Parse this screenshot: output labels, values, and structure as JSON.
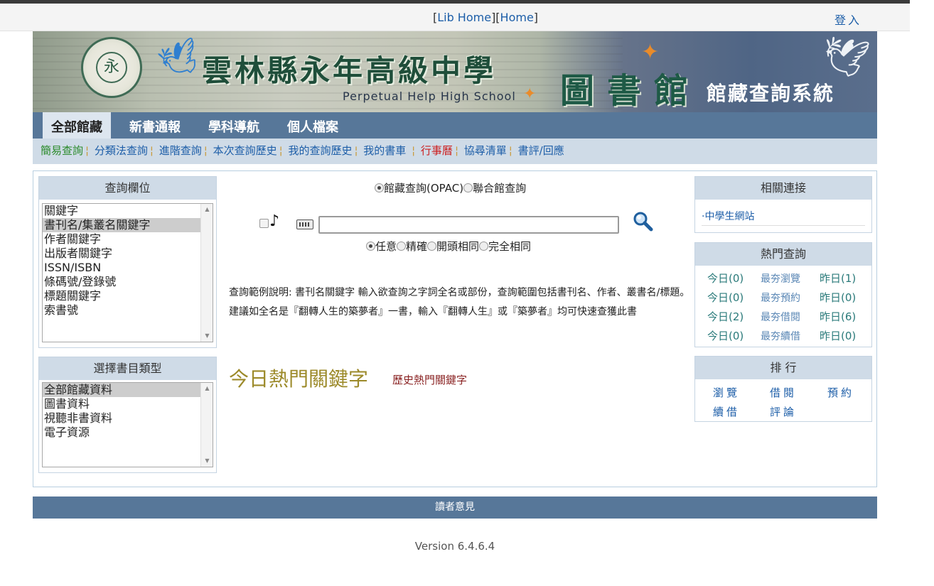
{
  "topbar": {
    "lib_home": "Lib Home",
    "home": "Home",
    "login": "登入"
  },
  "banner": {
    "title": "雲林縣永年高級中學",
    "subtitle": "Perpetual Help High School",
    "library": "圖書館",
    "system": "館藏查詢系統"
  },
  "tabs": [
    "全部館藏",
    "新書通報",
    "學科導航",
    "個人檔案"
  ],
  "subnav": [
    "簡易查詢",
    "分類法查詢",
    "進階查詢",
    "本次查詢歷史",
    "我的查詢歷史",
    "我的書車",
    "行事曆",
    "協尋清單",
    "書評/回應"
  ],
  "search_fields": {
    "title": "查詢欄位",
    "options": [
      "關鍵字",
      "書刊名/集叢名關鍵字",
      "作者關鍵字",
      "出版者關鍵字",
      "ISSN/ISBN",
      "條碼號/登錄號",
      "標題關鍵字",
      "索書號"
    ],
    "selected": 1
  },
  "book_types": {
    "title": "選擇書目類型",
    "options": [
      "全部館藏資料",
      "圖書資料",
      "視聽非書資料",
      "電子資源"
    ],
    "selected": 0
  },
  "search": {
    "scope_opac": "館藏查詢(OPAC)",
    "scope_union": "聯合館查詢",
    "query": "",
    "match": [
      "任意",
      "精確",
      "開頭相同",
      "完全相同"
    ]
  },
  "description": "查詢範例說明: 書刊名關鍵字 輸入欲查詢之字詞全名或部份，查詢範圍包括書刊名、作者、叢書名/標題。 建議如全名是『翻轉人生的築夢者』一書，輸入『翻轉人生』或『築夢者』均可快速查獲此書",
  "hot_keywords": {
    "today_title": "今日熱門關鍵字",
    "history_link": "歷史熱門關鍵字"
  },
  "related": {
    "title": "相關連接",
    "links": [
      "·中學生網站"
    ]
  },
  "popular": {
    "title": "熱門查詢",
    "rows": [
      {
        "today": "今日(0)",
        "label": "最夯瀏覽",
        "yesterday": "昨日(1)"
      },
      {
        "today": "今日(0)",
        "label": "最夯預約",
        "yesterday": "昨日(0)"
      },
      {
        "today": "今日(2)",
        "label": "最夯借閱",
        "yesterday": "昨日(6)"
      },
      {
        "today": "今日(0)",
        "label": "最夯續借",
        "yesterday": "昨日(0)"
      }
    ]
  },
  "ranking": {
    "title": "排 行",
    "items": [
      "瀏覽",
      "借閱",
      "預約",
      "續借",
      "評論"
    ]
  },
  "footer": {
    "feedback": "讀者意見",
    "version": "Version 6.4.6.4"
  },
  "colors": {
    "nav_blue": "#577799",
    "subnav_bg": "#cfdbe7",
    "link_blue": "#1d5ea8",
    "hot_gold": "#9c8a2a",
    "history_red": "#8a2323"
  }
}
